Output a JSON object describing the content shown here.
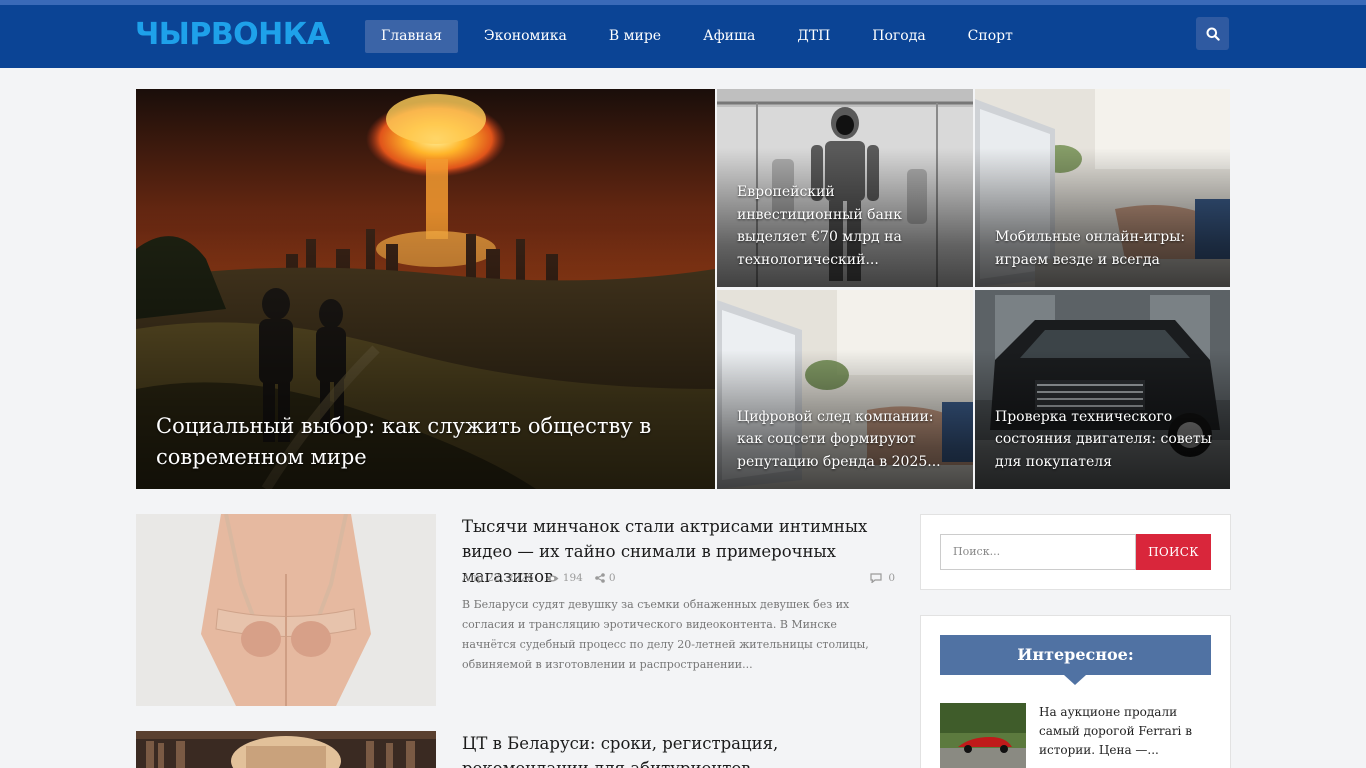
{
  "header": {
    "logo": "ЧЫРВОНКА",
    "nav": [
      "Главная",
      "Экономика",
      "В мире",
      "Афиша",
      "ДТП",
      "Погода",
      "Спорт"
    ],
    "active_nav": "Главная",
    "search_icon": "search-icon"
  },
  "hero": {
    "main": "Социальный выбор: как служить обществу в современном мире",
    "tiles": [
      "Европейский инвестиционный банк выделяет €70 млрд на технологический...",
      "Мобильные онлайн-игры: играем везде и всегда",
      "Цифровой след компании: как соцсети формируют репутацию бренда в 2025...",
      "Проверка технического состояния двигателя: советы для покупателя"
    ]
  },
  "articles": [
    {
      "title": "Тысячи минчанок стали актрисами интимных видео — их тайно снимали в примерочных магазинов",
      "date": "Апр 22, 2025",
      "views": "194",
      "shares": "0",
      "comments": "0",
      "excerpt": "В Беларуси судят девушку за съемки обнаженных девушек без их согласия и трансляцию эротического видеоконтента. В Минске начнётся судебный процесс по делу 20-летней жительницы столицы, обвиняемой в изготовлении и распространении..."
    },
    {
      "title": "ЦТ в Беларуси: сроки, регистрация, рекомендации для абитуриентов"
    }
  ],
  "sidebar": {
    "search_placeholder": "Поиск...",
    "search_button": "ПОИСК",
    "widget_title": "Интересное:",
    "item_text": "На аукционе продали самый дорогой Ferrari в истории. Цена —..."
  },
  "colors": {
    "header_bg": "#0b4495",
    "logo": "#1ea1ea",
    "nav_active": "#3b64a7",
    "search_submit": "#d9263b",
    "widget_title_bg": "#5072a3"
  }
}
